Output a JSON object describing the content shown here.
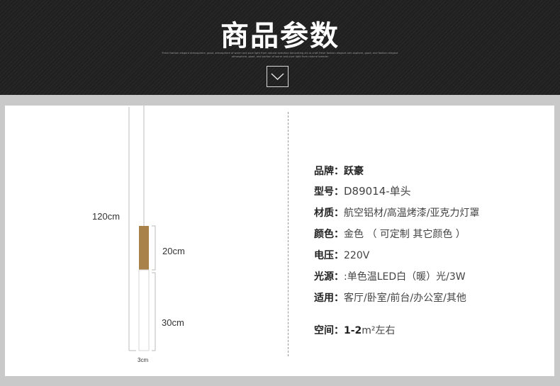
{
  "banner": {
    "title": "商品参数",
    "subtitle": "Fresh fashion elegant atmosphere, good, atmosphere of warm and pure light from natural selection decorating art-ro craft,Fresh fashion elegant atm osphere, good, and fashion elegant atmosphere, good, and portion of warm and pure light from natural breeder"
  },
  "dimensions": {
    "total_length": "120cm",
    "gold_section": "20cm",
    "white_section": "30cm",
    "diameter": "3cm"
  },
  "specs": [
    {
      "label": "品牌：",
      "value": "跃豪"
    },
    {
      "label": "型号：",
      "value": "D89014-单头"
    },
    {
      "label": "材质：",
      "value": "航空铝材/高温烤漆/亚克力灯罩"
    },
    {
      "label": "颜色：",
      "value": "金色 （  可定制 其它颜色 ）"
    },
    {
      "label": "电压：",
      "value": "220V"
    },
    {
      "label": "光源：",
      "value": ":单色温LED白（暖）光/3W"
    },
    {
      "label": "适用：",
      "value": "客厅/卧室/前台/办公室/其他"
    }
  ],
  "space": {
    "label": "空间：",
    "value_bold": "1-2",
    "value_unit": "m²左右"
  },
  "colors": {
    "gold": "#a9824a",
    "banner": "#222222",
    "background": "#c9c9c9"
  }
}
